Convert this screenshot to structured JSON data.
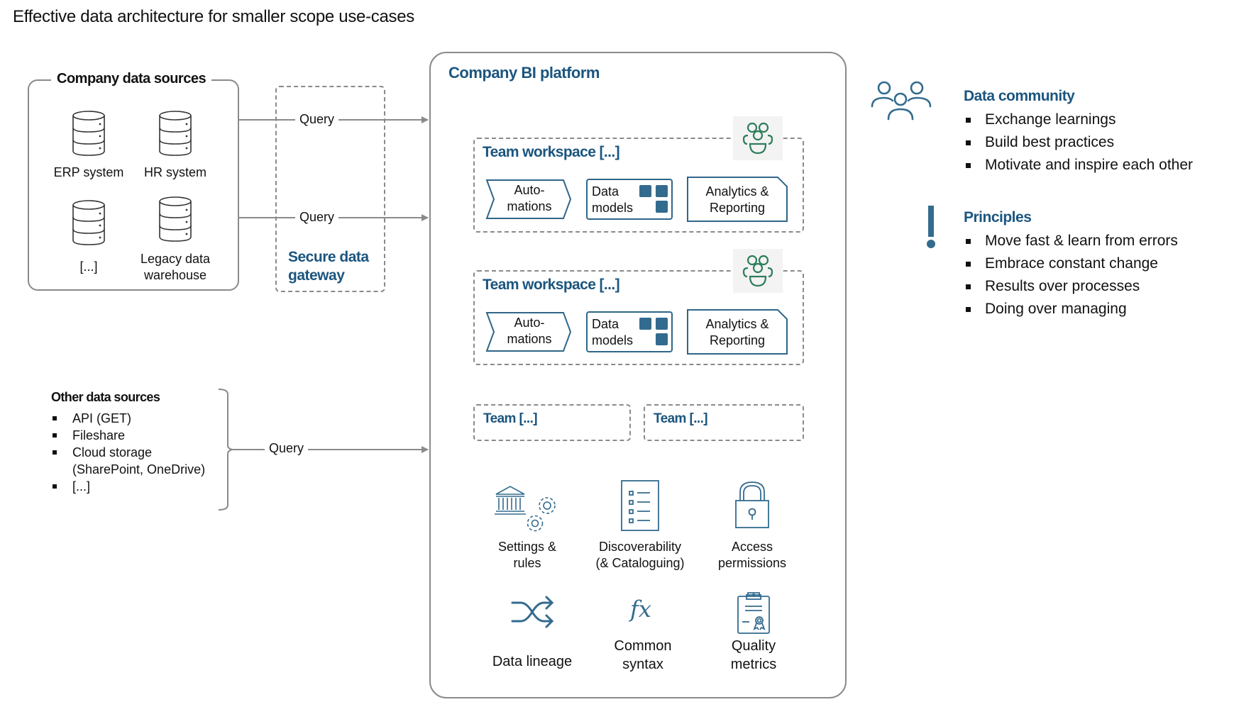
{
  "title": "Effective data architecture for smaller scope use-cases",
  "company_sources": {
    "heading": "Company data sources",
    "items": [
      {
        "label": "ERP system",
        "icon": "database-icon"
      },
      {
        "label": "HR system",
        "icon": "database-icon"
      },
      {
        "label": "[...]",
        "icon": "database-icon"
      },
      {
        "label_line1": "Legacy data",
        "label_line2": "warehouse",
        "icon": "database-icon"
      }
    ]
  },
  "gateway": {
    "label_line1": "Secure data",
    "label_line2": "gateway",
    "query_labels": [
      "Query",
      "Query"
    ]
  },
  "other_sources": {
    "heading": "Other data sources",
    "items": [
      "API (GET)",
      "Fileshare",
      "Cloud storage",
      "(SharePoint, OneDrive)",
      "[...]"
    ],
    "query_label": "Query"
  },
  "bi_platform": {
    "heading": "Company BI platform",
    "workspaces": [
      {
        "title": "Team workspace [...]",
        "automations_line1": "Auto-",
        "automations_line2": "mations",
        "models_line1": "Data",
        "models_line2": "models",
        "analytics_line1": "Analytics &",
        "analytics_line2": "Reporting"
      },
      {
        "title": "Team workspace [...]",
        "automations_line1": "Auto-",
        "automations_line2": "mations",
        "models_line1": "Data",
        "models_line2": "models",
        "analytics_line1": "Analytics &",
        "analytics_line2": "Reporting"
      }
    ],
    "teams": [
      "Team [...]",
      "Team [...]"
    ],
    "features": [
      {
        "line1": "Settings &",
        "line2": "rules",
        "icon": "governance-gears-icon"
      },
      {
        "line1": "Discoverability",
        "line2": "(& Cataloguing)",
        "icon": "checklist-icon"
      },
      {
        "line1": "Access",
        "line2": "permissions",
        "icon": "padlock-icon"
      },
      {
        "line1": "Data lineage",
        "line2": "",
        "icon": "shuffle-arrows-icon"
      },
      {
        "line1": "Common",
        "line2": "syntax",
        "icon": "fx-icon"
      },
      {
        "line1": "Quality",
        "line2": "metrics",
        "icon": "certificate-clipboard-icon"
      }
    ],
    "fx_glyph": "fx"
  },
  "data_community": {
    "heading": "Data community",
    "items": [
      "Exchange learnings",
      "Build best practices",
      "Motivate and inspire each other"
    ]
  },
  "principles": {
    "heading": "Principles",
    "items": [
      "Move fast & learn from errors",
      "Embrace constant change",
      "Results over processes",
      "Doing over managing"
    ]
  },
  "colors": {
    "accent_blue": "#1b557f",
    "icon_blue": "#336b8e",
    "team_green": "#2e7d5b",
    "line_gray": "#8a8a8a"
  }
}
